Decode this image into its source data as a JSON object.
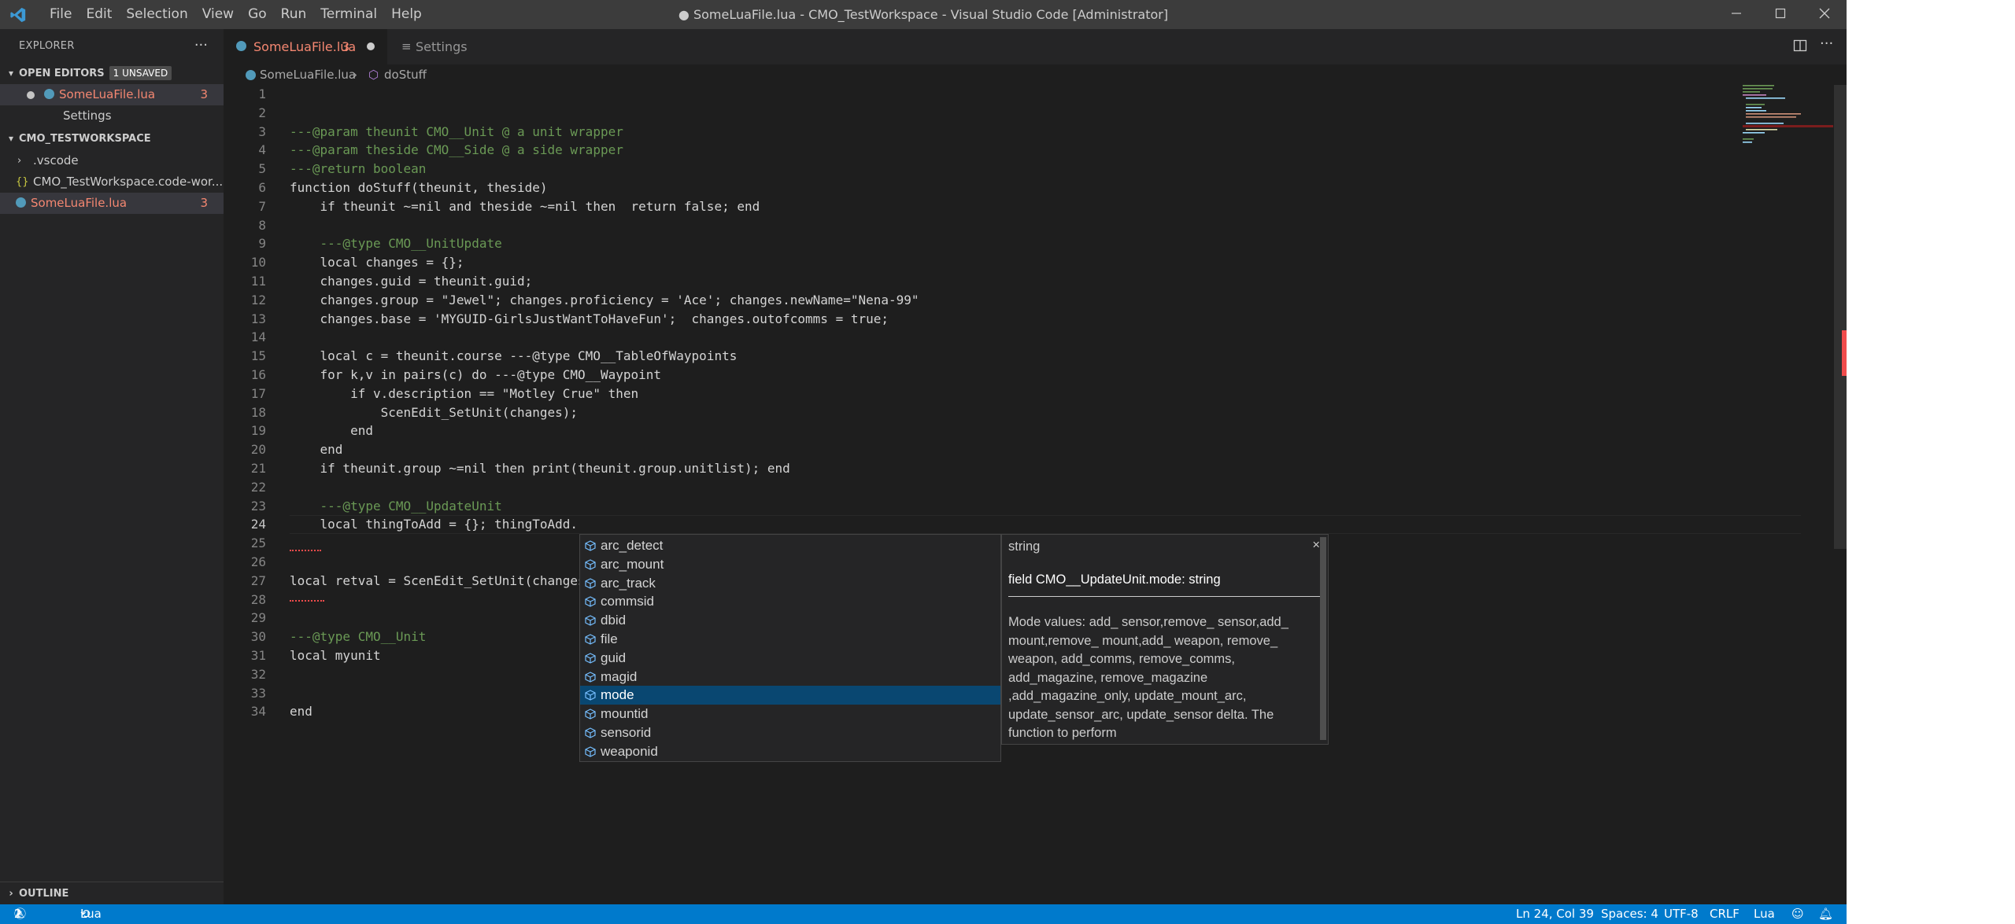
{
  "titlebar": {
    "menu": [
      "File",
      "Edit",
      "Selection",
      "View",
      "Go",
      "Run",
      "Terminal",
      "Help"
    ],
    "title": "● SomeLuaFile.lua - CMO_TestWorkspace - Visual Studio Code [Administrator]"
  },
  "sidebar": {
    "header": "EXPLORER",
    "open_editors": {
      "label": "OPEN EDITORS",
      "badge": "1 UNSAVED",
      "items": [
        {
          "name": "SomeLuaFile.lua",
          "problems": "3"
        },
        {
          "name": "Settings"
        }
      ]
    },
    "workspace": {
      "label": "CMO_TESTWORKSPACE",
      "items": [
        {
          "name": ".vscode"
        },
        {
          "name": "CMO_TestWorkspace.code-wor..."
        },
        {
          "name": "SomeLuaFile.lua",
          "problems": "3"
        }
      ]
    },
    "outline": "OUTLINE"
  },
  "tabs": [
    {
      "label": "SomeLuaFile.lua",
      "problems": "3"
    },
    {
      "label": "Settings"
    }
  ],
  "breadcrumb": {
    "file": "SomeLuaFile.lua",
    "symbol": "doStuff"
  },
  "editor": {
    "line_numbers": [
      "1",
      "2",
      "3",
      "4",
      "5",
      "6",
      "7",
      "8",
      "9",
      "10",
      "11",
      "12",
      "13",
      "14",
      "15",
      "16",
      "17",
      "18",
      "19",
      "20",
      "21",
      "22",
      "23",
      "24",
      "25",
      "26",
      "27",
      "28",
      "29",
      "30",
      "31",
      "32",
      "33",
      "34"
    ],
    "lines": [
      "",
      "",
      "---@param theunit CMO__Unit @ a unit wrapper",
      "---@param theside CMO__Side @ a side wrapper",
      "---@return boolean",
      "function doStuff(theunit, theside)",
      "    if theunit ~=nil and theside ~=nil then  return false; end",
      "",
      "    ---@type CMO__UnitUpdate",
      "    local changes = {};",
      "    changes.guid = theunit.guid;",
      "    changes.group = \"Jewel\"; changes.proficiency = 'Ace'; changes.newName=\"Nena-99\"",
      "    changes.base = 'MYGUID-GirlsJustWantToHaveFun';  changes.outofcomms = true;",
      "",
      "    local c = theunit.course ---@type CMO__TableOfWaypoints",
      "    for k,v in pairs(c) do ---@type CMO__Waypoint",
      "        if v.description == \"Motley Crue\" then",
      "            ScenEdit_SetUnit(changes);",
      "        end",
      "    end",
      "    if theunit.group ~=nil then print(theunit.group.unitlist); end",
      "",
      "    ---@type CMO__UpdateUnit",
      "    local thingToAdd = {}; thingToAdd.",
      "",
      "",
      "local retval = ScenEdit_SetUnit(changes",
      "",
      "",
      "---@type CMO__Unit",
      "local myunit",
      "",
      "",
      "end"
    ]
  },
  "suggest": {
    "items": [
      "arc_detect",
      "arc_mount",
      "arc_track",
      "commsid",
      "dbid",
      "file",
      "guid",
      "magid",
      "mode",
      "mountid",
      "sensorid",
      "weaponid"
    ],
    "selected": "mode",
    "detail": {
      "type": "string",
      "signature": "field CMO__UpdateUnit.mode: string",
      "doc": "Mode values: add_ sensor,remove_ sensor,add_ mount,remove_ mount,add_ weapon, remove_ weapon, add_comms, remove_comms, add_magazine, remove_magazine ,add_magazine_only, update_mount_arc, update_sensor_arc, update_sensor delta. The function to perform"
    }
  },
  "statusbar": {
    "errors": "2",
    "warnings": "1",
    "language_server": "Lua",
    "position": "Ln 24, Col 39",
    "indent": "Spaces: 4",
    "encoding": "UTF-8",
    "eol": "CRLF",
    "language": "Lua"
  },
  "colors": {
    "accent": "#007acc",
    "error": "#f48771",
    "selection": "#094771",
    "comment": "#6a9955",
    "type": "#4ec9b0",
    "string": "#ce9178",
    "keyword": "#c586c0"
  }
}
